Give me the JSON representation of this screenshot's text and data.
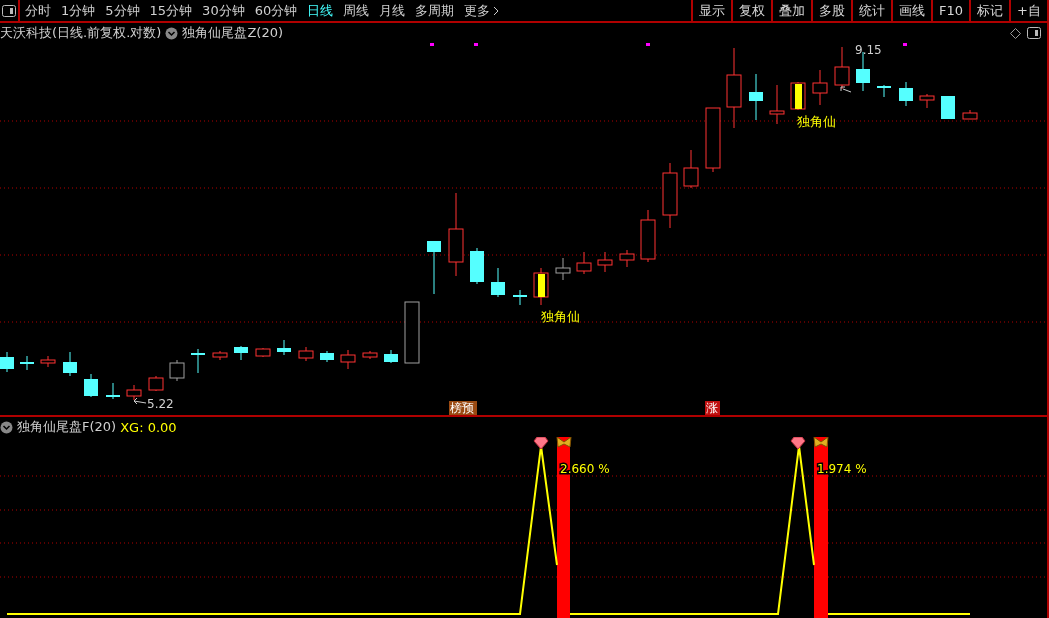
{
  "toolbar": {
    "periods": [
      {
        "label": "分时",
        "selected": false
      },
      {
        "label": "1分钟",
        "selected": false
      },
      {
        "label": "5分钟",
        "selected": false
      },
      {
        "label": "15分钟",
        "selected": false
      },
      {
        "label": "30分钟",
        "selected": false
      },
      {
        "label": "60分钟",
        "selected": false
      },
      {
        "label": "日线",
        "selected": true
      },
      {
        "label": "周线",
        "selected": false
      },
      {
        "label": "月线",
        "selected": false
      },
      {
        "label": "多周期",
        "selected": false
      }
    ],
    "more": "更多",
    "actions": [
      "显示",
      "复权",
      "叠加",
      "多股",
      "统计",
      "画线",
      "F10",
      "标记",
      "+自"
    ]
  },
  "main_panel": {
    "title": "天沃科技(日线.前复权.对数)",
    "indicator": "独角仙尾盘Z(20)",
    "high_label": "9.15",
    "low_label": "5.22",
    "signals": [
      "独角仙",
      "独角仙"
    ],
    "badges": [
      {
        "text": "榜预",
        "color": "#9a4a12"
      },
      {
        "text": "涨",
        "color": "#c01010"
      }
    ]
  },
  "sub_panel": {
    "title": "独角仙尾盘F(20)",
    "reading": "XG: 0.00",
    "values": [
      "2.660 %",
      "1.974 %"
    ]
  }
}
